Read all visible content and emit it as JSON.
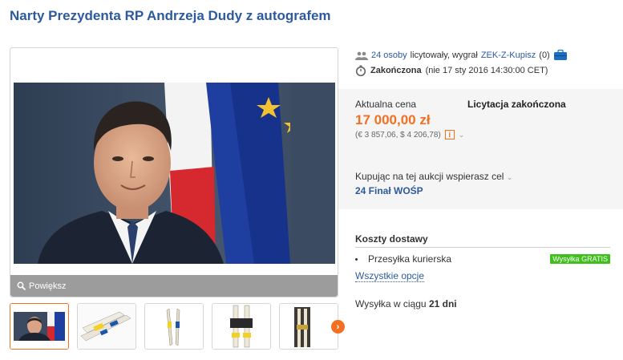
{
  "title": "Narty Prezydenta RP Andrzeja Dudy z autografem",
  "gallery": {
    "zoom_label": "Powiększ",
    "thumbnails": [
      "portrait",
      "ski-tips",
      "ski-pair",
      "ski-bindings",
      "skis-standing"
    ]
  },
  "auction": {
    "bidders_count": "24 osoby",
    "bidders_text": "licytowały, wygrał",
    "winner": "ZEK-Z-Kupisz",
    "winner_rating": "(0)",
    "status": "Zakończona",
    "end_date": "(nie 17 sty 2016 14:30:00 CET)"
  },
  "price": {
    "label": "Aktualna cena",
    "status": "Licytacja zakończona",
    "amount": "17 000,00 zł",
    "fx": "(€ 3 857,06, $ 4 206,78)"
  },
  "support": {
    "text": "Kupując na tej aukcji wspierasz cel",
    "cause": "24 Finał WOŚP"
  },
  "shipping": {
    "heading": "Koszty dostawy",
    "method": "Przesyłka kurierska",
    "badge": "Wysyłka GRATIS",
    "all_options": "Wszystkie opcje",
    "dispatch_prefix": "Wysyłka w ciągu",
    "dispatch_days": "21 dni"
  },
  "colors": {
    "title_blue": "#2d5a9e",
    "price_orange": "#f36f21",
    "free_green": "#3fbf1d"
  }
}
